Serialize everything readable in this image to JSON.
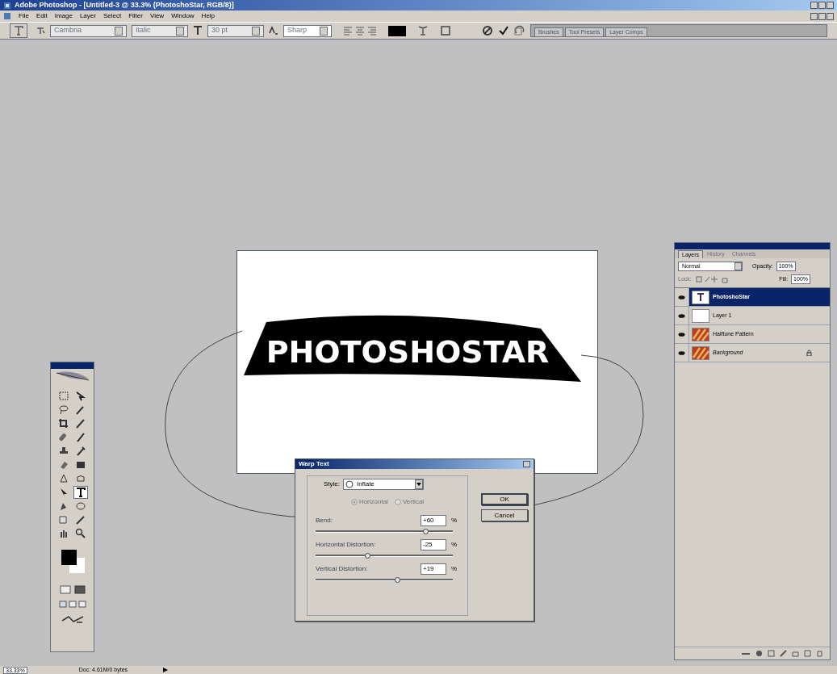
{
  "window": {
    "title": "Adobe Photoshop - [Untitled-3 @ 33.3% (PhotoshoStar, RGB/8)]"
  },
  "menu": [
    "File",
    "Edit",
    "Image",
    "Layer",
    "Select",
    "Filter",
    "View",
    "Window",
    "Help"
  ],
  "options_bar": {
    "font_family": "Cambria",
    "font_style": "Italic",
    "font_size": "30 pt",
    "antialias": "Sharp"
  },
  "palette_well": {
    "tabs": [
      "Brushes",
      "Tool Presets",
      "Layer Comps"
    ]
  },
  "document": {
    "text": "PHOTOSHOSTAR"
  },
  "toolbox": {
    "tools": [
      {
        "kind": "marquee",
        "selected": false
      },
      {
        "kind": "move",
        "selected": false
      },
      {
        "kind": "lasso",
        "selected": false
      },
      {
        "kind": "wand",
        "selected": false
      },
      {
        "kind": "crop",
        "selected": false
      },
      {
        "kind": "slice",
        "selected": false
      },
      {
        "kind": "heal",
        "selected": false
      },
      {
        "kind": "brush",
        "selected": false
      },
      {
        "kind": "stamp",
        "selected": false
      },
      {
        "kind": "history",
        "selected": false
      },
      {
        "kind": "eraser",
        "selected": false
      },
      {
        "kind": "gradient",
        "selected": false
      },
      {
        "kind": "blur",
        "selected": false
      },
      {
        "kind": "dodge",
        "selected": false
      },
      {
        "kind": "select",
        "selected": false
      },
      {
        "kind": "type",
        "selected": true
      },
      {
        "kind": "pen",
        "selected": false
      },
      {
        "kind": "shape",
        "selected": false
      },
      {
        "kind": "notes",
        "selected": false
      },
      {
        "kind": "eyedropper",
        "selected": false
      },
      {
        "kind": "hand",
        "selected": false
      },
      {
        "kind": "zoom",
        "selected": false
      }
    ]
  },
  "layers_panel": {
    "tabs": [
      {
        "label": "Layers",
        "selected": true
      },
      {
        "label": "History",
        "selected": false
      },
      {
        "label": "Channels",
        "selected": false
      }
    ],
    "blend_mode": "Normal",
    "opacity_label": "Opacity:",
    "opacity": "100%",
    "lock_label": "Lock:",
    "fill_label": "Fill:",
    "fill": "100%",
    "layers": [
      {
        "name": "PhotoshoStar",
        "kind": "text",
        "selected": true,
        "locked": false
      },
      {
        "name": "Layer 1",
        "kind": "blank",
        "selected": false,
        "locked": false
      },
      {
        "name": "Halftone Pattern",
        "kind": "pattern",
        "selected": false,
        "locked": false
      },
      {
        "name": "Background",
        "kind": "pattern",
        "selected": false,
        "locked": true
      }
    ]
  },
  "warp_dialog": {
    "title": "Warp Text",
    "style_label": "Style:",
    "style": "Inflate",
    "orientations": [
      {
        "label": "Horizontal",
        "selected": true
      },
      {
        "label": "Vertical",
        "selected": false
      }
    ],
    "sliders": [
      {
        "label": "Bend:",
        "value": "+60",
        "unit": "%",
        "level": 0.8
      },
      {
        "label": "Horizontal Distortion:",
        "value": "-25",
        "unit": "%",
        "level": 0.375
      },
      {
        "label": "Vertical Distortion:",
        "value": "+19",
        "unit": "%",
        "level": 0.595
      }
    ],
    "buttons": [
      "OK",
      "Cancel"
    ]
  },
  "status_bar": {
    "zoom": "33.33%",
    "doc": "Doc: 4.61M/0 bytes"
  }
}
